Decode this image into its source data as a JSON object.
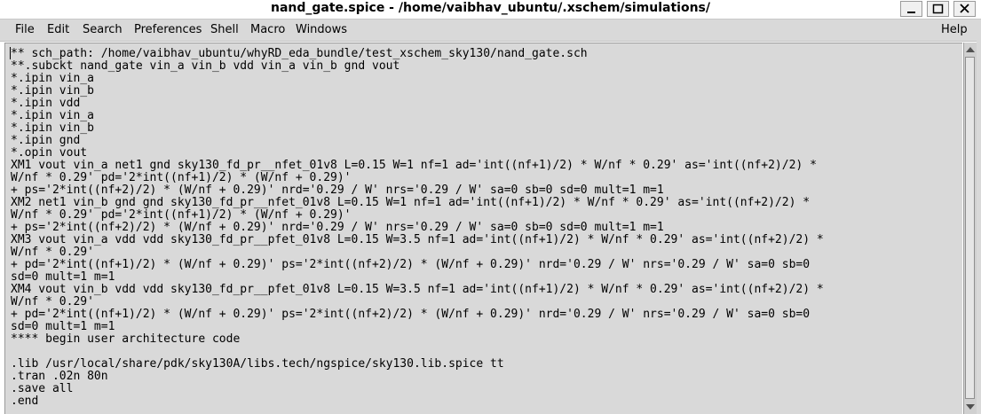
{
  "window": {
    "title": "nand_gate.spice - /home/vaibhav_ubuntu/.xschem/simulations/"
  },
  "menubar": {
    "items": [
      {
        "label": "File"
      },
      {
        "label": "Edit"
      },
      {
        "label": "Search"
      },
      {
        "label": "Preferences"
      },
      {
        "label": "Shell"
      },
      {
        "label": "Macro"
      },
      {
        "label": "Windows"
      }
    ],
    "help": "Help"
  },
  "editor": {
    "lines": [
      "** sch_path: /home/vaibhav_ubuntu/whyRD_eda_bundle/test_xschem_sky130/nand_gate.sch",
      "**.subckt nand_gate vin_a vin_b vdd vin_a vin_b gnd vout",
      "*.ipin vin_a",
      "*.ipin vin_b",
      "*.ipin vdd",
      "*.ipin vin_a",
      "*.ipin vin_b",
      "*.ipin gnd",
      "*.opin vout",
      "XM1 vout vin_a net1 gnd sky130_fd_pr__nfet_01v8 L=0.15 W=1 nf=1 ad='int((nf+1)/2) * W/nf * 0.29' as='int((nf+2)/2) *",
      "W/nf * 0.29' pd='2*int((nf+1)/2) * (W/nf + 0.29)'",
      "+ ps='2*int((nf+2)/2) * (W/nf + 0.29)' nrd='0.29 / W' nrs='0.29 / W' sa=0 sb=0 sd=0 mult=1 m=1",
      "XM2 net1 vin_b gnd gnd sky130_fd_pr__nfet_01v8 L=0.15 W=1 nf=1 ad='int((nf+1)/2) * W/nf * 0.29' as='int((nf+2)/2) *",
      "W/nf * 0.29' pd='2*int((nf+1)/2) * (W/nf + 0.29)'",
      "+ ps='2*int((nf+2)/2) * (W/nf + 0.29)' nrd='0.29 / W' nrs='0.29 / W' sa=0 sb=0 sd=0 mult=1 m=1",
      "XM3 vout vin_a vdd vdd sky130_fd_pr__pfet_01v8 L=0.15 W=3.5 nf=1 ad='int((nf+1)/2) * W/nf * 0.29' as='int((nf+2)/2) *",
      "W/nf * 0.29'",
      "+ pd='2*int((nf+1)/2) * (W/nf + 0.29)' ps='2*int((nf+2)/2) * (W/nf + 0.29)' nrd='0.29 / W' nrs='0.29 / W' sa=0 sb=0",
      "sd=0 mult=1 m=1",
      "XM4 vout vin_b vdd vdd sky130_fd_pr__pfet_01v8 L=0.15 W=3.5 nf=1 ad='int((nf+1)/2) * W/nf * 0.29' as='int((nf+2)/2) *",
      "W/nf * 0.29'",
      "+ pd='2*int((nf+1)/2) * (W/nf + 0.29)' ps='2*int((nf+2)/2) * (W/nf + 0.29)' nrd='0.29 / W' nrs='0.29 / W' sa=0 sb=0",
      "sd=0 mult=1 m=1",
      "**** begin user architecture code",
      "",
      ".lib /usr/local/share/pdk/sky130A/libs.tech/ngspice/sky130.lib.spice tt",
      ".tran .02n 80n",
      ".save all",
      ".end"
    ]
  }
}
